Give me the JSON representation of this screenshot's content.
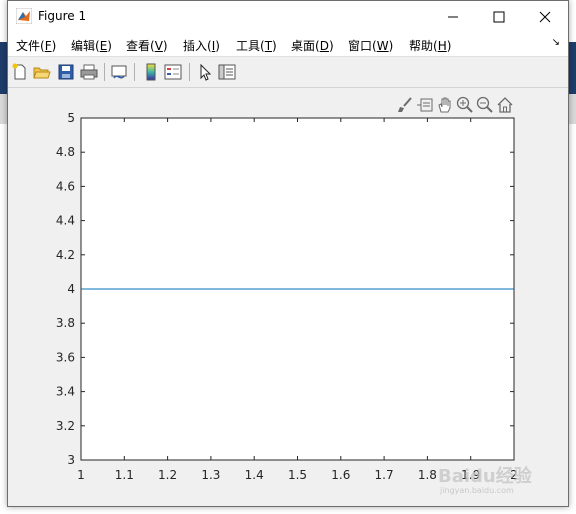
{
  "window": {
    "title": "Figure 1"
  },
  "menu": [
    {
      "text": "文件(",
      "key": "F",
      "end": ")"
    },
    {
      "text": "编辑(",
      "key": "E",
      "end": ")"
    },
    {
      "text": "查看(",
      "key": "V",
      "end": ")"
    },
    {
      "text": "插入(",
      "key": "I",
      "end": ")"
    },
    {
      "text": "工具(",
      "key": "T",
      "end": ")"
    },
    {
      "text": "桌面(",
      "key": "D",
      "end": ")"
    },
    {
      "text": "窗口(",
      "key": "W",
      "end": ")"
    },
    {
      "text": "帮助(",
      "key": "H",
      "end": ")"
    }
  ],
  "toolbar_icons": [
    "new-figure-icon",
    "open-file-icon",
    "save-icon",
    "print-icon",
    "link-plot-icon",
    "colorbar-icon",
    "legend-icon",
    "edit-plot-icon",
    "property-inspector-icon"
  ],
  "axes_toolbar_icons": [
    "brush-icon",
    "data-tips-icon",
    "pan-icon",
    "zoom-in-icon",
    "zoom-out-icon",
    "home-icon"
  ],
  "chart_data": {
    "type": "line",
    "x": [
      1,
      2
    ],
    "series": [
      {
        "values": [
          4,
          4
        ],
        "color": "#0072bd"
      }
    ],
    "xlim": [
      1,
      2
    ],
    "ylim": [
      3,
      5
    ],
    "xticks": [
      "1",
      "1.1",
      "1.2",
      "1.3",
      "1.4",
      "1.5",
      "1.6",
      "1.7",
      "1.8",
      "1.9",
      "2"
    ],
    "yticks": [
      "3",
      "3.2",
      "3.4",
      "3.6",
      "3.8",
      "4",
      "4.2",
      "4.4",
      "4.6",
      "4.8",
      "5"
    ],
    "title": "",
    "xlabel": "",
    "ylabel": "",
    "grid": false
  },
  "watermark": {
    "text": "Baidu经验",
    "sub": "jingyan.baidu.com"
  }
}
